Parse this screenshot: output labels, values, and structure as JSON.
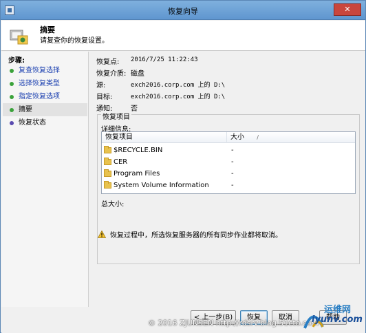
{
  "window": {
    "title": "恢复向导",
    "close_glyph": "✕"
  },
  "header": {
    "title": "摘要",
    "subtitle": "请复查你的恢复设置。"
  },
  "sidebar": {
    "steps_label": "步骤:",
    "items": [
      {
        "label": "复查恢复选择",
        "state": "done"
      },
      {
        "label": "选择恢复类型",
        "state": "done"
      },
      {
        "label": "指定恢复选项",
        "state": "done"
      },
      {
        "label": "摘要",
        "state": "active"
      },
      {
        "label": "恢复状态",
        "state": "pending"
      }
    ]
  },
  "summary": {
    "recovery_point_label": "恢复点:",
    "recovery_point_value": "2016/7/25 11:22:43",
    "media_label": "恢复介质:",
    "media_value": "磁盘",
    "source_label": "源:",
    "source_value": "exch2016.corp.com 上的 D:\\",
    "target_label": "目标:",
    "target_value": "exch2016.corp.com 上的 D:\\",
    "notify_label": "通知:",
    "notify_value": "否"
  },
  "items_group": {
    "title": "恢复项目",
    "details_label": "详细信息:",
    "columns": [
      "恢复项目",
      "大小"
    ],
    "rows": [
      {
        "name": "$RECYCLE.BIN",
        "size": "-"
      },
      {
        "name": "CER",
        "size": "-"
      },
      {
        "name": "Program Files",
        "size": "-"
      },
      {
        "name": "System Volume Information",
        "size": "-"
      }
    ],
    "total_label": "总大小:"
  },
  "warning": {
    "text": "恢复过程中，所选恢复服务器的所有同步作业都将取消。"
  },
  "buttons": {
    "back": "< 上一步(B)",
    "recover": "恢复",
    "cancel": "取消",
    "help": "帮助"
  },
  "watermark": {
    "text": "© 2016 ZJUNSEN http://rdsrv.blog.51cto.com",
    "brand_cn": "运维网",
    "brand_url": "iyunv.com"
  },
  "colors": {
    "titlebar": "#6fa3d7",
    "link_step": "#1a3fb0",
    "done_bullet": "#3aa23a",
    "pending_bullet": "#5a4bb0"
  },
  "icons": {
    "title": "app-icon",
    "header": "recovery-summary-icon",
    "warning": "warning-icon",
    "folder": "folder-icon"
  }
}
